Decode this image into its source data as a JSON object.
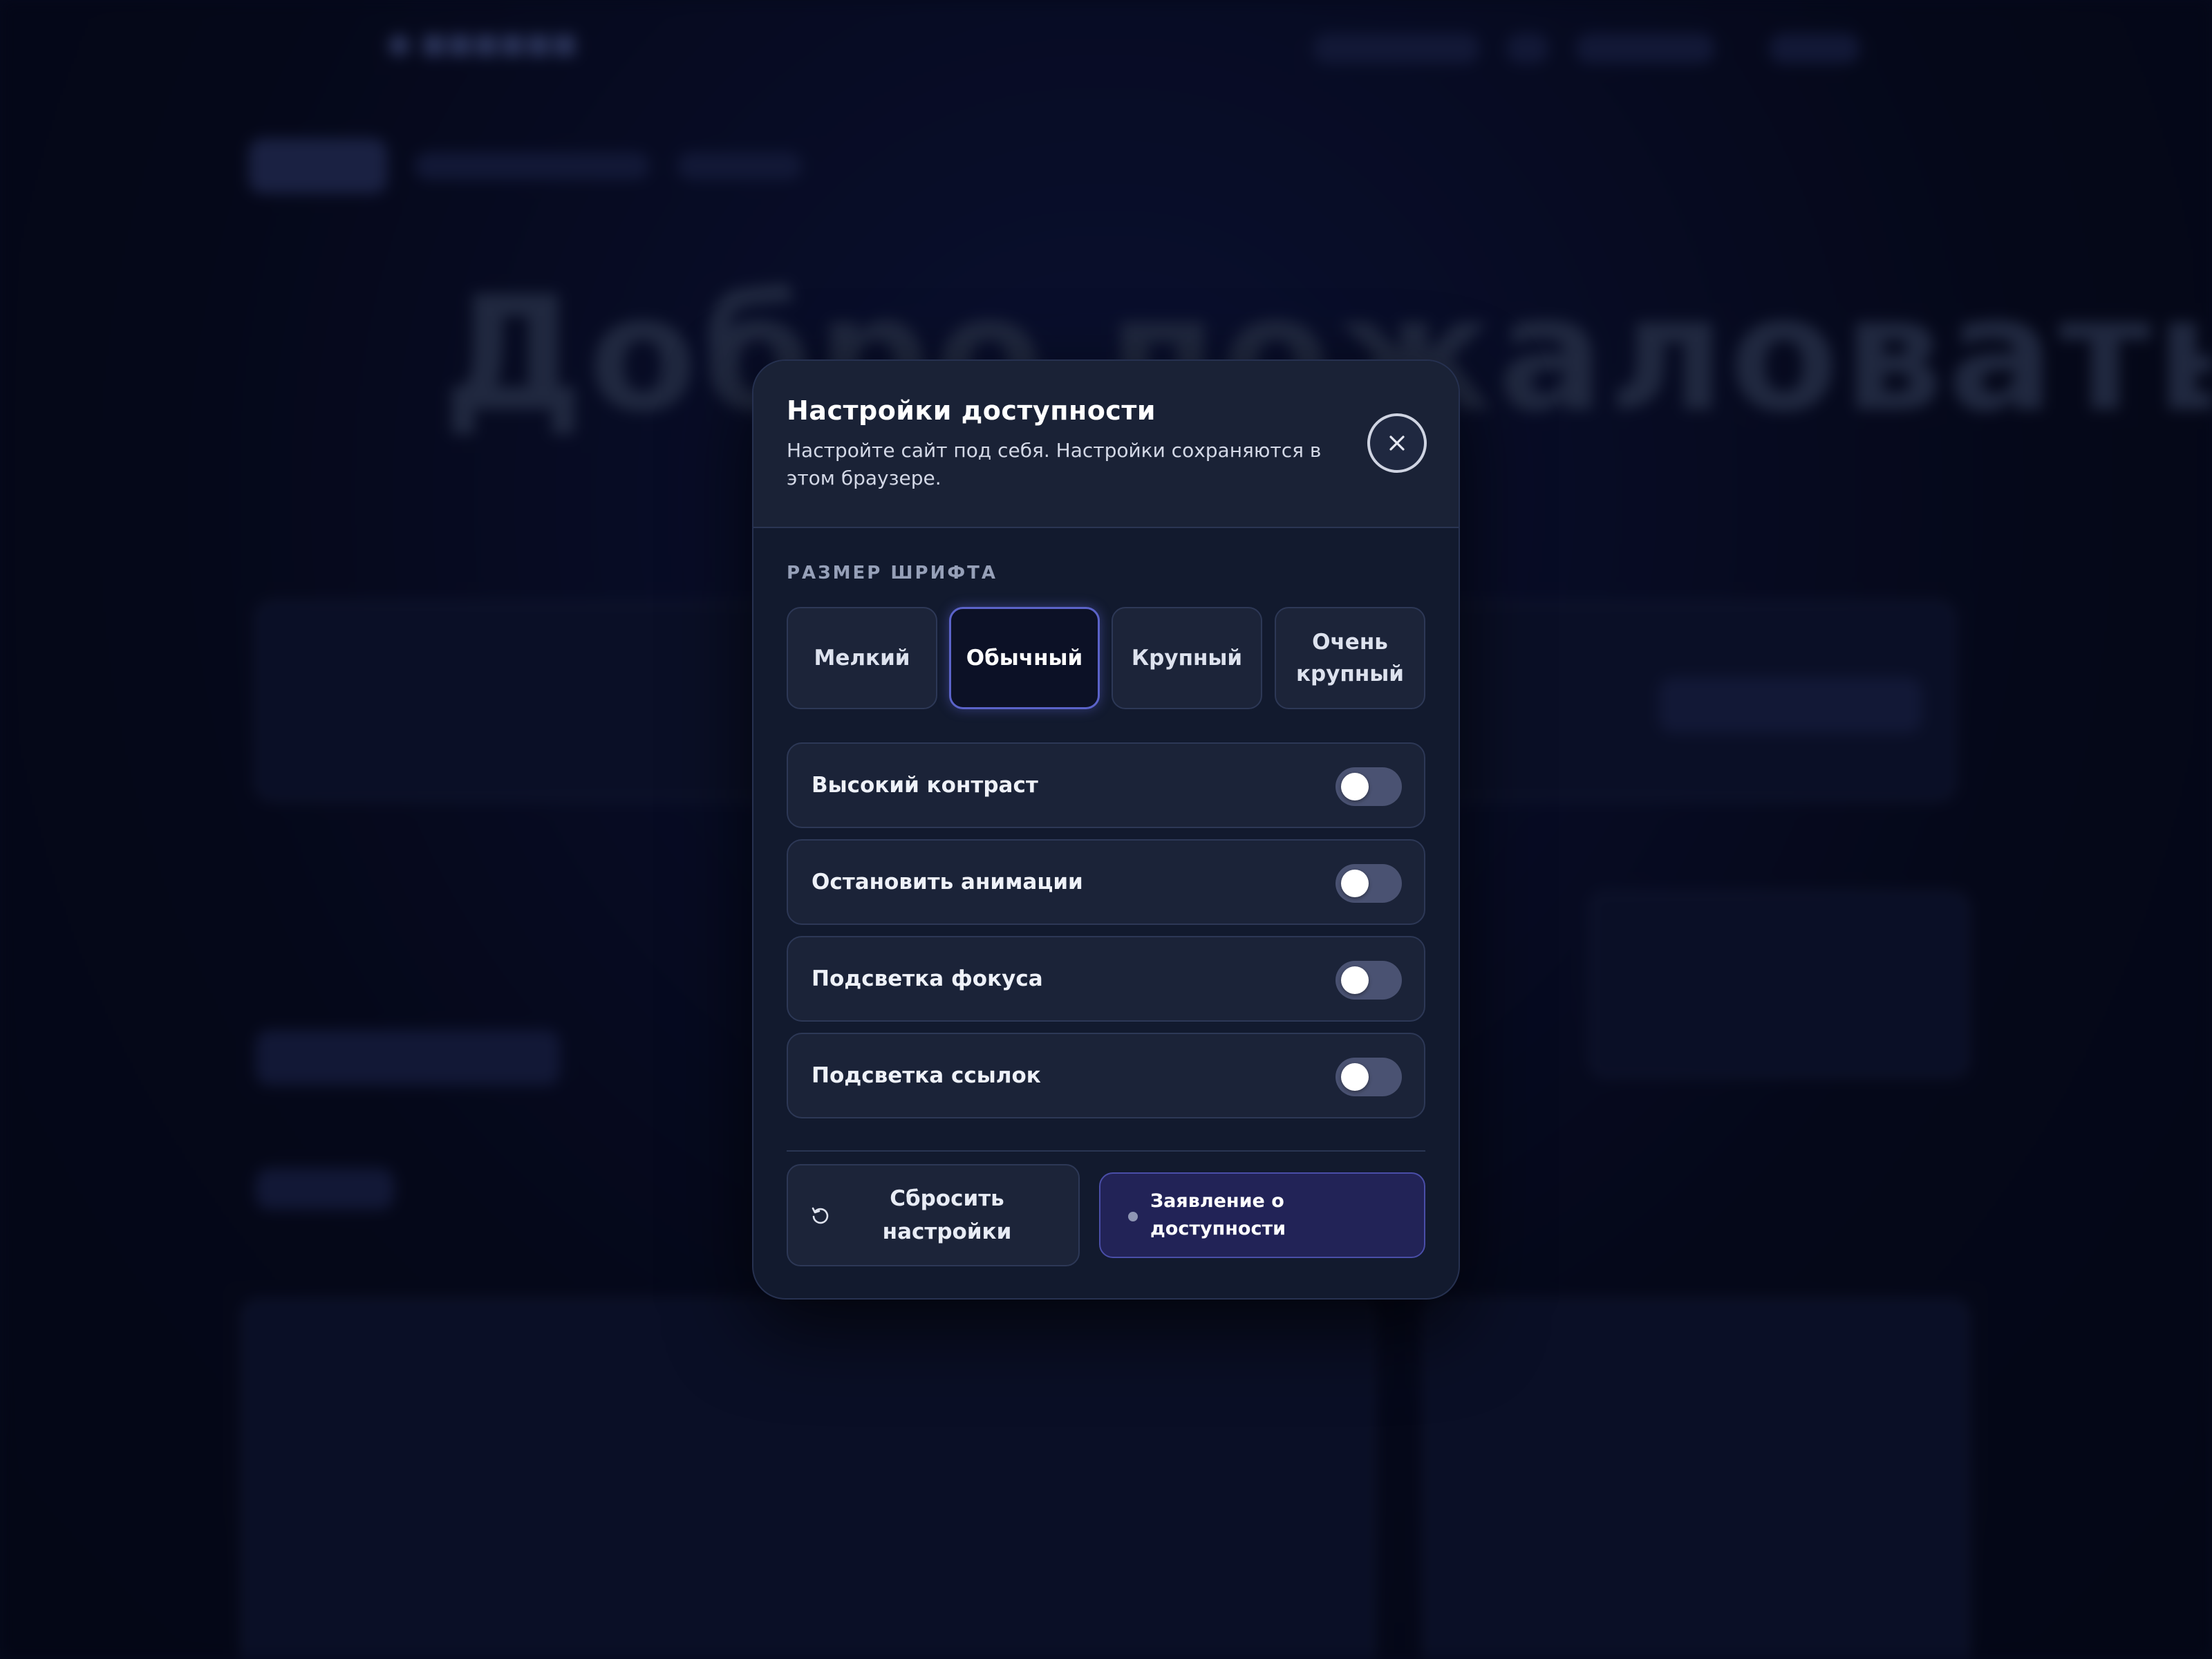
{
  "background": {
    "site_title": "",
    "hero_text": "Добро пожаловать !"
  },
  "modal": {
    "title": "Настройки доступности",
    "subtitle": "Настройте сайт под себя. Настройки сохраняются в этом браузере.",
    "close_icon": "close-icon",
    "font_size_section": {
      "label": "РАЗМЕР ШРИФТА",
      "options": [
        {
          "label": "Мелкий",
          "selected": false
        },
        {
          "label": "Обычный",
          "selected": true
        },
        {
          "label": "Крупный",
          "selected": false
        },
        {
          "label": "Очень крупный",
          "selected": false
        }
      ]
    },
    "toggles": [
      {
        "label": "Высокий контраст",
        "on": false
      },
      {
        "label": "Остановить анимации",
        "on": false
      },
      {
        "label": "Подсветка фокуса",
        "on": false
      },
      {
        "label": "Подсветка ссылок",
        "on": false
      }
    ],
    "footer": {
      "reset_label": "Сбросить настройки",
      "reset_icon": "reset-icon",
      "statement_label": "Заявление о доступности"
    }
  },
  "colors": {
    "accent": "#5b63c9",
    "modal_bg": "#121a2e",
    "statement_bg": "#222357"
  }
}
